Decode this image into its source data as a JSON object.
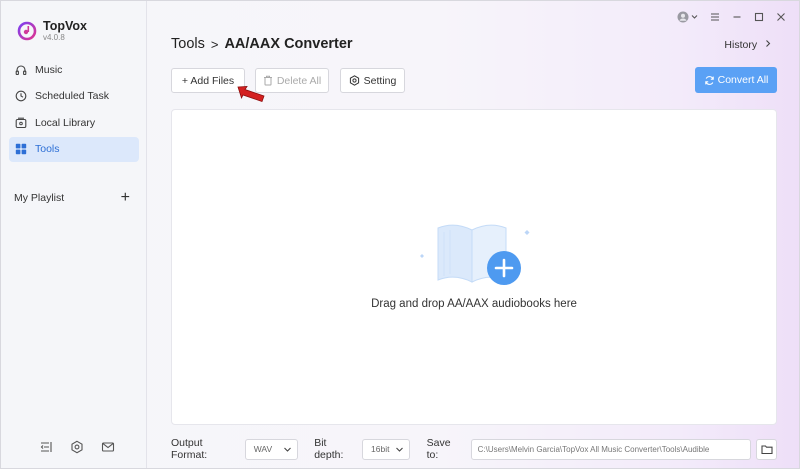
{
  "app": {
    "name": "TopVox",
    "version": "v4.0.8"
  },
  "sidebar": {
    "items": [
      {
        "label": "Music",
        "icon": "headphones-icon"
      },
      {
        "label": "Scheduled Task",
        "icon": "clock-icon"
      },
      {
        "label": "Local Library",
        "icon": "library-icon"
      },
      {
        "label": "Tools",
        "icon": "grid-icon"
      }
    ],
    "active": "Tools",
    "playlist_label": "My Playlist",
    "playlist_add": "+"
  },
  "header": {
    "breadcrumb_root": "Tools",
    "breadcrumb_sep": ">",
    "breadcrumb_current": "AA/AAX Converter",
    "history": "History"
  },
  "toolbar": {
    "add_files": "+ Add Files",
    "delete_all": "Delete All",
    "setting": "Setting",
    "convert_all": "Convert All"
  },
  "dropzone": {
    "text": "Drag and drop AA/AAX audiobooks here"
  },
  "bottom": {
    "output_format_label": "Output Format:",
    "output_format_value": "WAV",
    "bit_depth_label": "Bit depth:",
    "bit_depth_value": "16bit",
    "save_to_label": "Save to:",
    "save_to_path": "C:\\Users\\Melvin Garcia\\TopVox All Music Converter\\Tools\\Audible"
  },
  "colors": {
    "accent": "#5aa1f5",
    "active_bg": "#dce8fb",
    "active_text": "#2d6fd6",
    "pointer": "#d42020"
  }
}
